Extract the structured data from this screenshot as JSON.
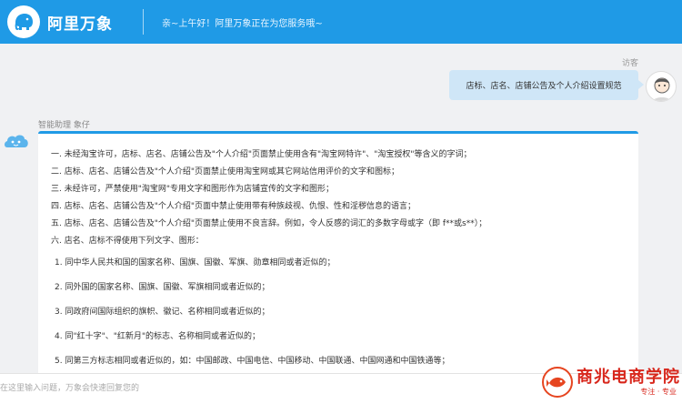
{
  "header": {
    "logo_icon": "elephant-icon",
    "brand": "阿里万象",
    "greeting": "亲~上午好！阿里万象正在为您服务哦~",
    "bg_color": "#1f9ae6"
  },
  "visitor": {
    "label": "访客",
    "message": "店标、店名、店铺公告及个人介绍设置规范",
    "avatar_icon": "user-avatar-icon"
  },
  "bot": {
    "label": "智能助理 象仔",
    "avatar_icon": "cloud-bot-icon",
    "lines": [
      "一. 未经淘宝许可，店标、店名、店铺公告及\"个人介绍\"页面禁止使用含有\"淘宝网特许\"、\"淘宝授权\"等含义的字词；",
      "二. 店标、店名、店铺公告及\"个人介绍\"页面禁止使用淘宝网或其它网站信用评价的文字和图标；",
      "三. 未经许可，严禁使用\"淘宝网\"专用文字和图形作为店铺宣传的文字和图形；",
      "四. 店标、店名、店铺公告及\"个人介绍\"页面中禁止使用带有种族歧视、仇恨、性和淫秽信息的语言；",
      "五. 店标、店名、店铺公告及\"个人介绍\"页面禁止使用不良言辞。例如，令人反感的词汇的多数字母或字（即 f**或s**）；",
      "六. 店名、店标不得使用下列文字、图形："
    ],
    "sub_items": [
      "1. 同中华人民共和国的国家名称、国旗、国徽、军旗、勋章相同或者近似的；",
      "2. 同外国的国家名称、国旗、国徽、军旗相同或者近似的；",
      "3. 同政府间国际组织的旗帜、徽记、名称相同或者近似的；",
      "4. 同\"红十字\"、\"红新月\"的标志、名称相同或者近似的；",
      "5. 同第三方标志相同或者近似的，如：中国邮政、中国电信、中国移动、中国联通、中国网通和中国铁通等；"
    ]
  },
  "input": {
    "placeholder": "在这里输入问题，万象会快速回复您的"
  },
  "watermark": {
    "title": "商兆电商学院",
    "subtitle": "专注 · 专业"
  }
}
